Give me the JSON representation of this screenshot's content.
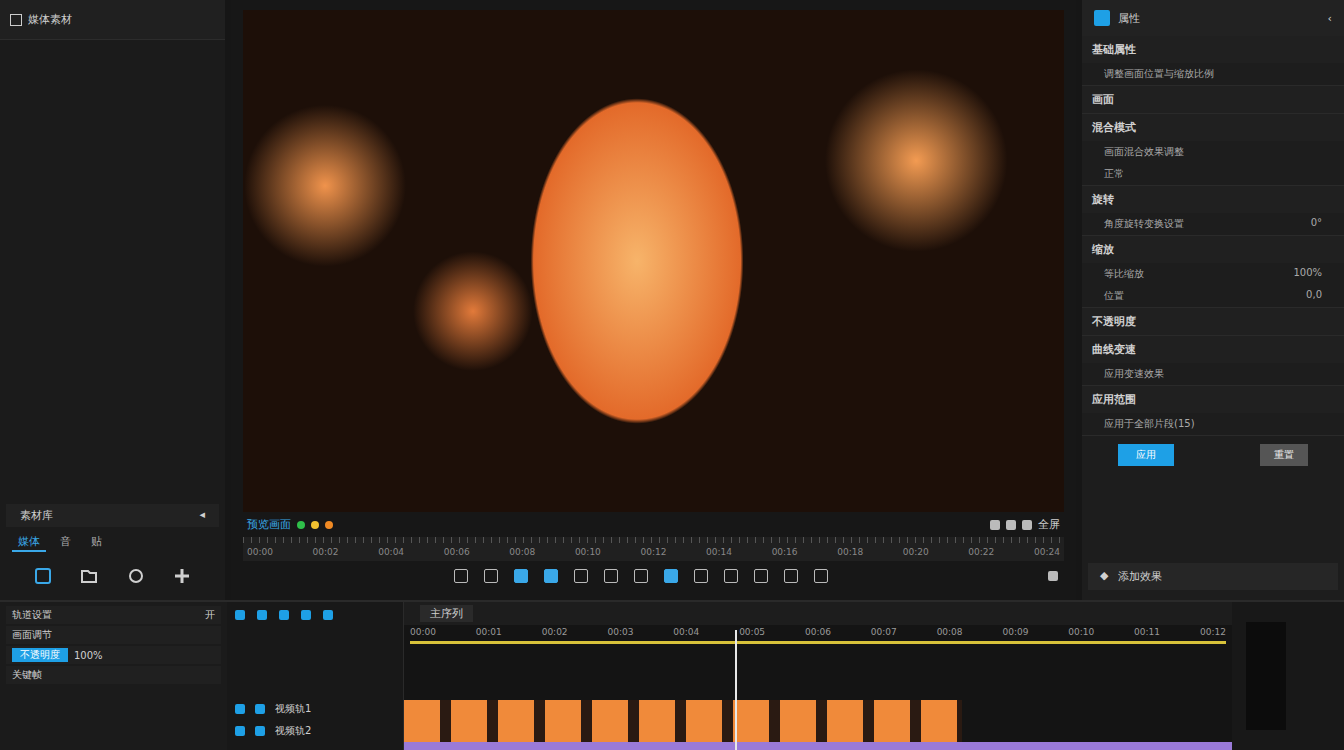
{
  "media_panel": {
    "title": "媒体素材",
    "section": "素材库",
    "section_icon": "◂",
    "tabs": [
      {
        "label": "媒体",
        "selected": true
      },
      {
        "label": "音",
        "selected": false
      },
      {
        "label": "贴",
        "selected": false
      }
    ]
  },
  "preview": {
    "label": "预览画面",
    "dots": [
      {
        "color": "#2fbf4a"
      },
      {
        "color": "#f2c230"
      },
      {
        "color": "#f08a24"
      }
    ],
    "fullscreen": "全屏",
    "ruler": [
      "00:00",
      "00:02",
      "00:04",
      "00:06",
      "00:08",
      "00:10",
      "00:12",
      "00:14",
      "00:16",
      "00:18",
      "00:20",
      "00:22",
      "00:24"
    ]
  },
  "properties": {
    "title": "属性",
    "sections": [
      {
        "title": "基础属性",
        "rows": [
          {
            "label": "调整画面位置与缩放比例",
            "value": ""
          }
        ]
      },
      {
        "title": "画面",
        "rows": []
      },
      {
        "title": "混合模式",
        "rows": [
          {
            "label": "画面混合效果调整",
            "value": ""
          },
          {
            "label": "正常",
            "value": ""
          }
        ]
      },
      {
        "title": "旋转",
        "rows": [
          {
            "label": "角度旋转变换设置",
            "value": "0°"
          }
        ]
      },
      {
        "title": "缩放",
        "rows": [
          {
            "label": "等比缩放",
            "value": "100%"
          },
          {
            "label": "位置",
            "value": "0,0"
          }
        ]
      },
      {
        "title": "不透明度",
        "rows": []
      },
      {
        "title": "曲线变速",
        "rows": [
          {
            "label": "应用变速效果",
            "value": ""
          }
        ]
      },
      {
        "title": "应用范围",
        "rows": [
          {
            "label": "应用于全部片段(15)",
            "value": ""
          }
        ]
      }
    ],
    "buttons": [
      {
        "label": "应用",
        "primary": true
      },
      {
        "label": "重置",
        "primary": false
      }
    ],
    "footer": "添加效果"
  },
  "tracks_panel": {
    "title": "轨道设置",
    "toggle": "开",
    "rows": [
      {
        "label": "画面调节",
        "value": ""
      },
      {
        "label": "不透明度",
        "value": "100%"
      },
      {
        "label": "关键帧",
        "value": ""
      }
    ]
  },
  "track_headers": [
    {
      "label": "视频轨1"
    },
    {
      "label": "视频轨2"
    }
  ],
  "timeline": {
    "sequence": "主序列",
    "ruler": [
      "00:00",
      "00:01",
      "00:02",
      "00:03",
      "00:04",
      "00:05",
      "00:06",
      "00:07",
      "00:08",
      "00:09",
      "00:10",
      "00:11",
      "00:12"
    ],
    "playhead": {
      "level": 0.4
    }
  }
}
